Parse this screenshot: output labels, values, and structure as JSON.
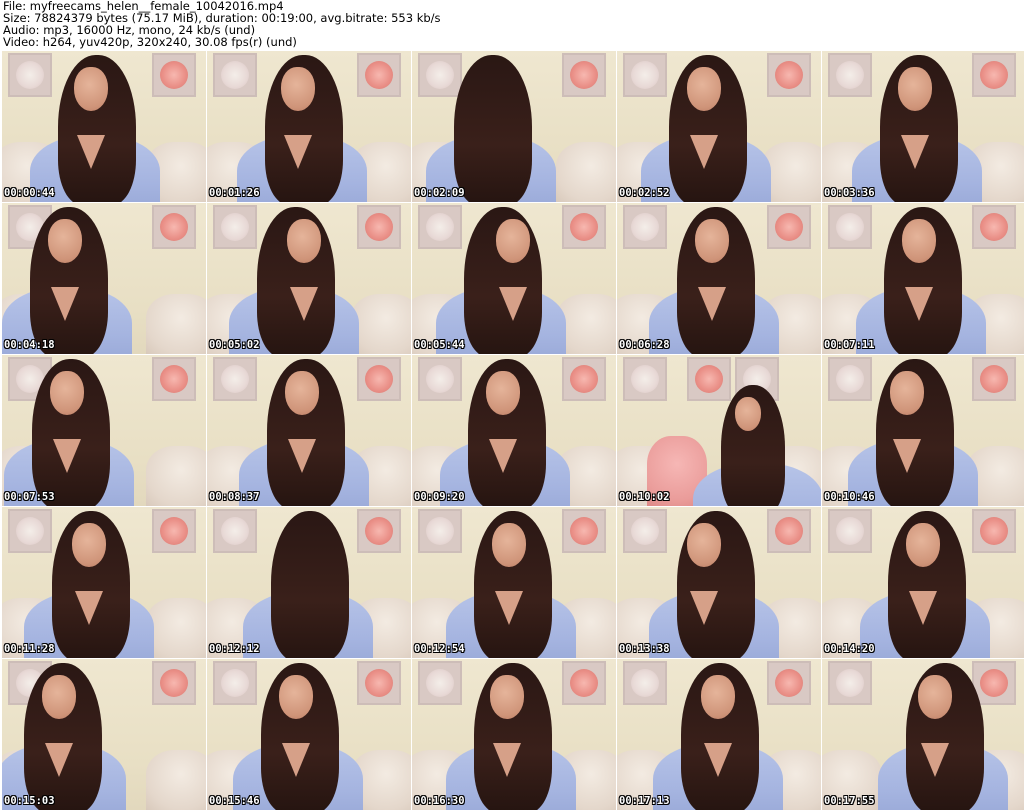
{
  "header": {
    "file": "File: myfreecams_helen__female_10042016.mp4",
    "size": "Size: 78824379 bytes (75.17 MiB), duration: 00:19:00, avg.bitrate: 553 kb/s",
    "audio": "Audio: mp3, 16000 Hz, mono, 24 kb/s (und)",
    "video": "Video: h264, yuv420p, 320x240, 30.08 fps(r) (und)"
  },
  "thumbnails": [
    {
      "timestamp": "00:00:44"
    },
    {
      "timestamp": "00:01:26"
    },
    {
      "timestamp": "00:02:09"
    },
    {
      "timestamp": "00:02:52"
    },
    {
      "timestamp": "00:03:36"
    },
    {
      "timestamp": "00:04:18"
    },
    {
      "timestamp": "00:05:02"
    },
    {
      "timestamp": "00:05:44"
    },
    {
      "timestamp": "00:06:28"
    },
    {
      "timestamp": "00:07:11"
    },
    {
      "timestamp": "00:07:53"
    },
    {
      "timestamp": "00:08:37"
    },
    {
      "timestamp": "00:09:20"
    },
    {
      "timestamp": "00:10:02"
    },
    {
      "timestamp": "00:10:46"
    },
    {
      "timestamp": "00:11:28"
    },
    {
      "timestamp": "00:12:12"
    },
    {
      "timestamp": "00:12:54"
    },
    {
      "timestamp": "00:13:38"
    },
    {
      "timestamp": "00:14:20"
    },
    {
      "timestamp": "00:15:03"
    },
    {
      "timestamp": "00:15:46"
    },
    {
      "timestamp": "00:16:30"
    },
    {
      "timestamp": "00:17:13"
    },
    {
      "timestamp": "00:17:55"
    }
  ],
  "colors": {
    "background": "#ffffff",
    "wall": "#eee6cf",
    "shirt": "#a5b4e0",
    "hair": "#2a1714",
    "skin": "#cf9479",
    "timestamp_text": "#ffffff"
  }
}
